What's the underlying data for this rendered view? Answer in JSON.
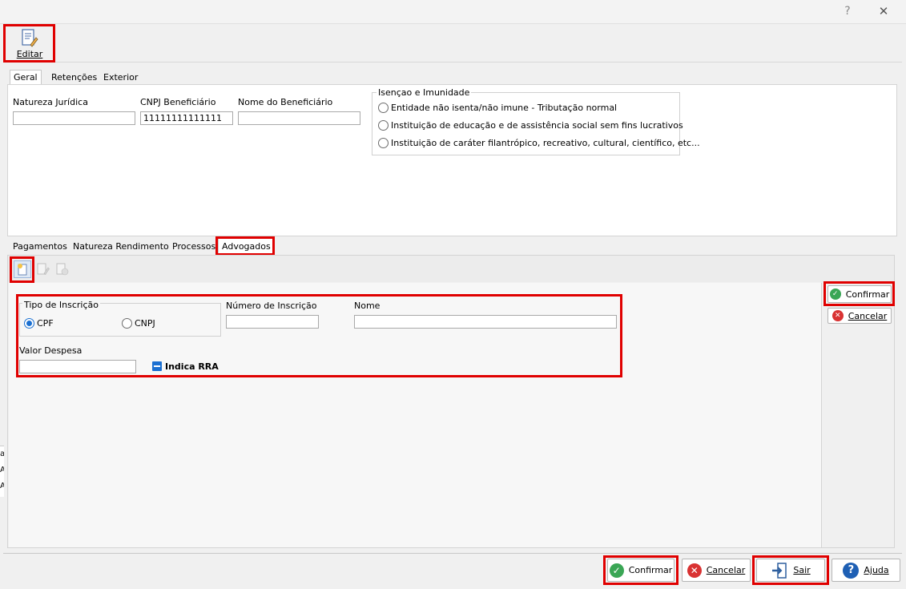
{
  "window": {
    "help_glyph": "?",
    "close_glyph": "✕"
  },
  "toolbar": {
    "edit_label": "Editar"
  },
  "top_tabs": [
    "Geral",
    "Retenções",
    "Exterior"
  ],
  "geral": {
    "natureza_label": "Natureza Jurídica",
    "natureza_value": "",
    "cnpj_label": "CNPJ Beneficiário",
    "cnpj_value": "11111111111111",
    "nome_label": "Nome do Beneficiário",
    "nome_value": "",
    "isencao": {
      "title": "Isençao e Imunidade",
      "options": [
        "Entidade não isenta/não imune - Tributação normal",
        "Instituição de educação e de assistência social sem fins lucrativos",
        "Instituição de caráter filantrópico, recreativo, cultural, científico, etc..."
      ]
    }
  },
  "sub_tabs": [
    "Pagamentos",
    "Natureza Rendimento",
    "Processos",
    "Advogados"
  ],
  "advogados": {
    "tipo_inscricao_label": "Tipo de Inscrição",
    "cpf_label": "CPF",
    "cnpj_label": "CNPJ",
    "numero_label": "Número de Inscrição",
    "numero_value": "",
    "nome_label": "Nome",
    "nome_value": "",
    "valor_label": "Valor Despesa",
    "valor_value": "",
    "rra_label": "Indica RRA",
    "confirm_label": "Confirmar",
    "cancel_label": "Cancelar"
  },
  "footer": {
    "confirm_label": "Confirmar",
    "cancel_label": "Cancelar",
    "exit_label": "Sair",
    "help_label": "Ajuda"
  },
  "background_fragments": [
    "a",
    "A",
    "A"
  ],
  "colors": {
    "highlight": "#e00000",
    "accent": "#1a6fd1",
    "confirm": "#3aa655",
    "cancel": "#d93232",
    "help": "#1e5fb4"
  }
}
